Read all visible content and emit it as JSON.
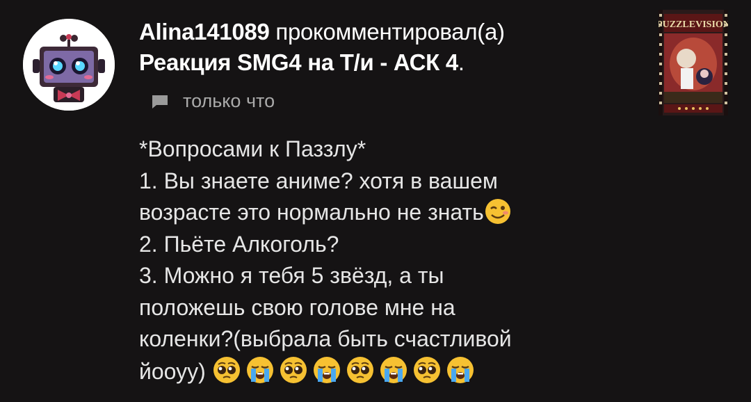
{
  "notification": {
    "username": "Alina141089",
    "action": "прокомментировал(а)",
    "post_title": "Реакция SMG4 на Т/и - АСК 4",
    "title_end": ".",
    "timestamp": "только что",
    "thumbnail_title": "PUZZLEVISION",
    "icons": {
      "avatar": "robot-avatar",
      "comment": "comment-icon",
      "thumbnail": "post-thumbnail"
    }
  },
  "comment": {
    "lines": [
      "*Вопросами к Паззлу*",
      "1. Вы знаете аниме? хотя в вашем",
      "возрасте это нормально не знать",
      "2. Пьёте Алкоголь?",
      "3. Можно я тебя 5 звёзд, а ты",
      "положешь свою голове мне на",
      "коленки?(выбрала быть счастливой",
      "йооуу)"
    ],
    "inline_emoji": "winking-face",
    "trailing_emojis": [
      "pleading-face",
      "crying-face",
      "pleading-face",
      "crying-face",
      "pleading-face",
      "crying-face",
      "pleading-face",
      "crying-face"
    ]
  },
  "colors": {
    "background": "#151314",
    "text": "#ffffff",
    "muted": "#aaaaaa"
  }
}
